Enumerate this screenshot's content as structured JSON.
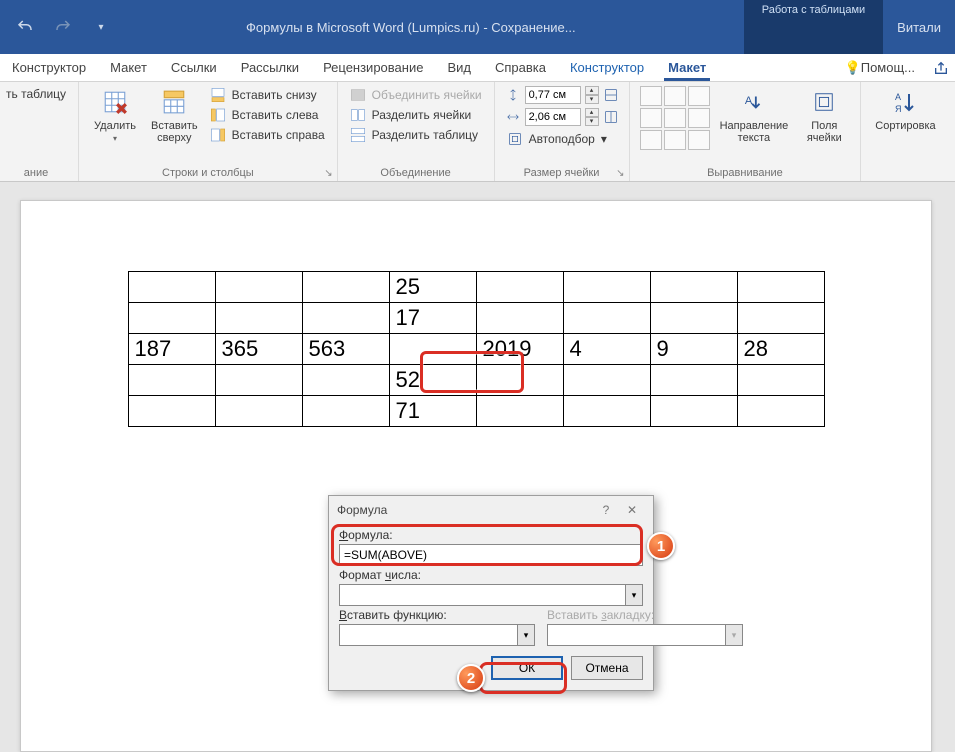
{
  "titlebar": {
    "doc_title": "Формулы в Microsoft Word (Lumpics.ru)  -  Сохранение...",
    "context_title": "Работа с таблицами",
    "user": "Витали"
  },
  "tabs": {
    "konstruktor": "Конструктор",
    "maket": "Макет",
    "ssylki": "Ссылки",
    "rassylki": "Рассылки",
    "retsenz": "Рецензирование",
    "vid": "Вид",
    "spravka": "Справка",
    "t_konstruktor": "Конструктор",
    "t_maket": "Макет",
    "pomosh": "Помощ..."
  },
  "ribbon": {
    "tablica": {
      "nacherit": "ть таблицу",
      "group": "ание"
    },
    "rows": {
      "udalit": "Удалить",
      "vstavit_sverhu": "Вставить\nсверху",
      "vstavit_snizu": "Вставить снизу",
      "vstavit_sleva": "Вставить слева",
      "vstavit_sprava": "Вставить справа",
      "group": "Строки и столбцы"
    },
    "merge": {
      "obedinit": "Объединить ячейки",
      "razdelit_c": "Разделить ячейки",
      "razdelit_t": "Разделить таблицу",
      "group": "Объединение"
    },
    "size": {
      "h": "0,77 см",
      "w": "2,06 см",
      "autofit": "Автоподбор",
      "group": "Размер ячейки"
    },
    "align": {
      "napr": "Направление\nтекста",
      "polya": "Поля\nячейки",
      "group": "Выравнивание"
    },
    "sort": {
      "sort": "Сортировка"
    }
  },
  "table": {
    "r0": [
      "",
      "",
      "",
      "25",
      "",
      "",
      "",
      ""
    ],
    "r1": [
      "",
      "",
      "",
      "17",
      "",
      "",
      "",
      ""
    ],
    "r2": [
      "187",
      "365",
      "563",
      "",
      "2019",
      "4",
      "9",
      "28"
    ],
    "r3": [
      "",
      "",
      "",
      "52",
      "",
      "",
      "",
      ""
    ],
    "r4": [
      "",
      "",
      "",
      "71",
      "",
      "",
      "",
      ""
    ]
  },
  "dialog": {
    "title": "Формула",
    "formula_label": "Формула:",
    "formula_value": "=SUM(ABOVE)",
    "format_label": "Формат числа:",
    "func_label": "Вставить функцию:",
    "bookmark_label": "Вставить закладку:",
    "ok": "ОК",
    "cancel": "Отмена"
  },
  "badges": {
    "one": "1",
    "two": "2"
  }
}
